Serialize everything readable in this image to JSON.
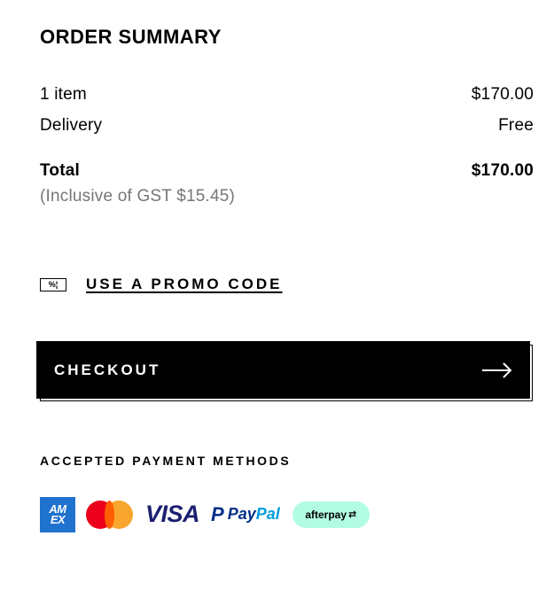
{
  "summary": {
    "title": "ORDER SUMMARY",
    "items_label": "1 item",
    "items_value": "$170.00",
    "delivery_label": "Delivery",
    "delivery_value": "Free",
    "total_label": "Total",
    "total_value": "$170.00",
    "gst_note": "(Inclusive of GST  $15.45)"
  },
  "promo": {
    "icon_text": "%¦",
    "icon_name": "promo-code-icon",
    "label": "USE A PROMO CODE"
  },
  "checkout": {
    "label": "CHECKOUT",
    "icon_name": "arrow-right-icon"
  },
  "payment": {
    "title": "ACCEPTED PAYMENT METHODS",
    "methods": {
      "amex_line1": "AM",
      "amex_line2": "EX",
      "visa": "VISA",
      "paypal_p": "P",
      "paypal_pay": "Pay",
      "paypal_pal": "Pal",
      "afterpay": "afterpay",
      "afterpay_icon": "⇄"
    }
  },
  "colors": {
    "text": "#000000",
    "muted": "#767677",
    "button_bg": "#000000",
    "button_text": "#ffffff",
    "amex": "#1f72cd",
    "mastercard_red": "#eb001b",
    "mastercard_orange": "#f79e1b",
    "visa": "#1a1f71",
    "paypal_dark": "#003087",
    "paypal_light": "#009cde",
    "afterpay_bg": "#b2fce4"
  }
}
